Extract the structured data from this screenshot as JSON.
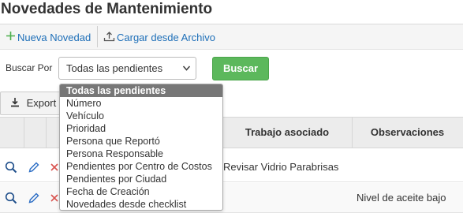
{
  "page": {
    "title": "Novedades de Mantenimiento"
  },
  "toolbar": {
    "new_label": "Nueva Novedad",
    "upload_label": "Cargar desde Archivo"
  },
  "search": {
    "label": "Buscar Por",
    "selected": "Todas las pendientes",
    "button_label": "Buscar",
    "options": [
      "Todas las pendientes",
      "Número",
      "Vehículo",
      "Prioridad",
      "Persona que Reportó",
      "Persona Responsable",
      "Pendientes por Centro de Costos",
      "Pendientes por Ciudad",
      "Fecha de Creación",
      "Novedades desde checklist"
    ]
  },
  "export": {
    "label": "Export"
  },
  "table": {
    "headers": {
      "trabajo": "Trabajo asociado",
      "observaciones": "Observaciones"
    },
    "rows": [
      {
        "trabajo": "Revisar Vidrio Parabrisas",
        "observaciones": ""
      },
      {
        "trabajo": "",
        "observaciones": "Nivel de aceite bajo"
      }
    ]
  },
  "colors": {
    "accent_link": "#1e6fb8",
    "success_button": "#5cb85c",
    "selected_option_bg": "#777777",
    "delete_icon": "#d9534f",
    "plus_icon": "#4cae4c"
  }
}
